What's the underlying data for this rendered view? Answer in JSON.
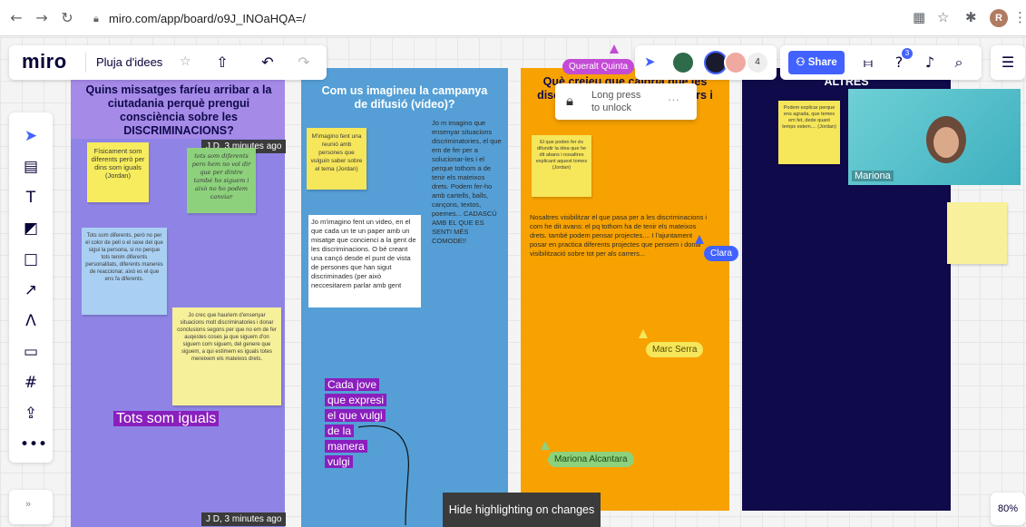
{
  "browser": {
    "url": "miro.com/app/board/o9J_INOaHQA=/",
    "profile_initial": "R"
  },
  "toolbar": {
    "logo": "miro",
    "board_name": "Pluja d'idees",
    "share_label": "Share",
    "help_badge": "3",
    "collaborator_count": "4"
  },
  "frames": [
    {
      "title": "Quins missatges faríeu arribar a la ciutadania perquè prengui consciència sobre les DISCRIMINACIONS?",
      "color": "#8f84e6",
      "title_bg": "#a58ae8"
    },
    {
      "title": "Com us imagineu la campanya de difusió (vídeo)?",
      "color": "#559fd6"
    },
    {
      "title": "Què creieu que caldria que les discriminacions ... a Consellers i Conselleres?",
      "color": "#f7a200"
    },
    {
      "title": "ALTRES",
      "color": "#0f0a4a"
    }
  ],
  "stickies": {
    "f1_s1": "Físicament som diferents però per dins som iguals (Jordan)",
    "f1_s2": "tots som diferents pero hem no vol dir que per dintre també ho siguem i això no ho podem canviar",
    "f1_s3": "Tots som diferents, però no per el color de pell o el sexe del que sigui la persona, si no perque tots tenim diferents personalitats, diferents maneres de reaccionar, això es el que ens fa diferents.",
    "f1_s4": "Jo crec que hauriem d'ensenyar situacions molt discriminatories i donar conclusions segons per que no em de fer auqestes coses ja que siguem d'on siguem com siguem, del genere que siguem, a qui estimem es iguals totes mereixem els mateixos drets.",
    "f2_s1": "M'imagino fent una reunió amb persones que vulguin saber sobre el tema (Jordan)",
    "f2_text1": "Jo m imagino que ensenyar situacions discriminatories, el que em de fer per a solucionar-les i el perque tothom a de tenir els mateixos drets. Podem fer-ho amb cartells, balls, cançons, textos, poemes... CADASCÚ AMB EL QUE ES SENTI MÉS COMODE!!",
    "f2_text2": "Jo m'imagino fent un video, en el que cada un te un paper amb un misatge que concienci a la gent de les discriminacions. O bé creant una cançó desde el punt de vista de persones que han sigut discriminades (per això neccesitarem parlar amb gent",
    "f3_s1": "El que poden fer és difundir la idea que he dit abans i nosaltres explicant aquest tomes (Jordan)",
    "f3_text1": "Nosaltres visibilitzar el que pasa per a les discriminacions i com he dit avans: el pq tothom ha de tenir els mateixos drets. també podem pensar projectes.... I l'ajuntament posar en practica diferents projectes que pensem i donar visibilització sobre tot per als carrers...",
    "f4_s1": "Podem explicar perque ens agrada, que temes em fet, dede quant temps estem.... (Jordan)"
  },
  "highlights": {
    "tots_som_iguals": "Tots som iguals",
    "cada_jove": [
      "Cada jove",
      "que expresi",
      "el que vulgi",
      "de la",
      "manera",
      "vulgi"
    ]
  },
  "timestamps": {
    "frame1_top": "J D, 3 minutes ago",
    "frame1_bottom": "J D, 3 minutes ago"
  },
  "cursors": {
    "queralt": "Queralt Quinta",
    "clara": "Clara",
    "marc": "Marc Serra",
    "mariona_a": "Mariona Alcantara"
  },
  "lock_popup": {
    "line1": "Long press",
    "line2": "to unlock"
  },
  "video": {
    "name": "Mariona"
  },
  "bottom": {
    "hide_highlight": "Hide highlighting on changes",
    "zoom": "80%"
  }
}
